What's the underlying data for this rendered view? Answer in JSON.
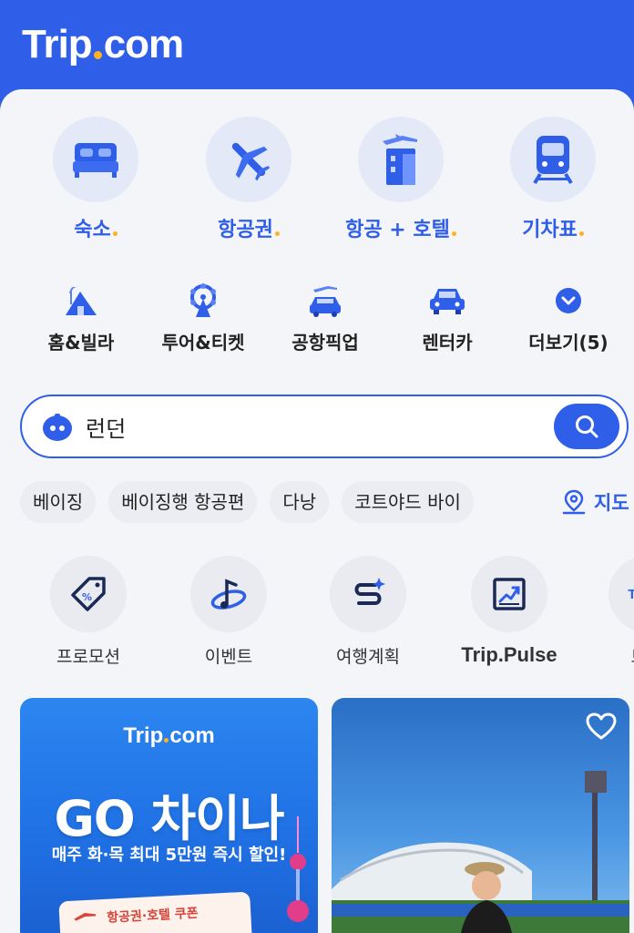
{
  "header": {
    "logo_left": "Trip",
    "logo_right": "com"
  },
  "main_categories": [
    {
      "label": "숙소",
      "icon": "bed-icon"
    },
    {
      "label": "항공권",
      "icon": "airplane-icon"
    },
    {
      "label": "항공 + 호텔",
      "icon": "flight-hotel-icon"
    },
    {
      "label": "기차표",
      "icon": "train-icon"
    }
  ],
  "sub_categories": [
    {
      "label": "홈&빌라",
      "icon": "villa-icon"
    },
    {
      "label": "투어&티켓",
      "icon": "ferris-wheel-icon"
    },
    {
      "label": "공항픽업",
      "icon": "airport-pickup-icon"
    },
    {
      "label": "렌터카",
      "icon": "car-icon"
    },
    {
      "label": "더보기(5)",
      "icon": "chevron-down-icon"
    }
  ],
  "search": {
    "value": "런던"
  },
  "chips": [
    "베이징",
    "베이징행 항공편",
    "다낭",
    "코트야드 바이"
  ],
  "map_label": "지도",
  "services": [
    {
      "label": "프로모션",
      "icon": "tag-icon"
    },
    {
      "label": "이벤트",
      "icon": "event-icon"
    },
    {
      "label": "여행계획",
      "icon": "route-icon"
    },
    {
      "label": "Trip.Pulse",
      "icon": "trend-chart-icon"
    },
    {
      "label": "트립",
      "icon": "trip-icon"
    }
  ],
  "promo_card": {
    "logo_left": "Trip",
    "logo_right": "com",
    "title": "GO 차이나",
    "subtitle": "매주 화·목 최대 5만원 즉시 할인!",
    "ticket_text": "항공권·호텔 쿠폰"
  },
  "colors": {
    "brand": "#2f5ee8",
    "accent_dot": "#ffb21e"
  }
}
